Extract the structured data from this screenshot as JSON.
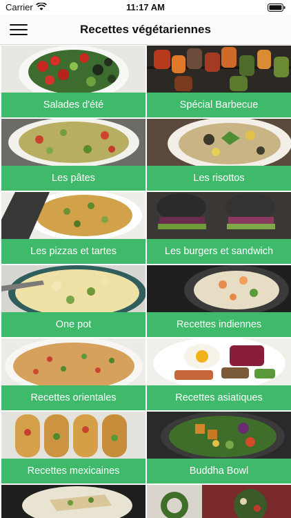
{
  "status_bar": {
    "carrier": "Carrier",
    "time": "11:17 AM"
  },
  "header": {
    "title": "Recettes végétariennes"
  },
  "categories": [
    {
      "label": "Salades d'été"
    },
    {
      "label": "Spécial Barbecue"
    },
    {
      "label": "Les pâtes"
    },
    {
      "label": "Les risottos"
    },
    {
      "label": "Les pizzas et tartes"
    },
    {
      "label": "Les burgers et sandwich"
    },
    {
      "label": "One pot"
    },
    {
      "label": "Recettes indiennes"
    },
    {
      "label": "Recettes orientales"
    },
    {
      "label": "Recettes asiatiques"
    },
    {
      "label": "Recettes mexicaines"
    },
    {
      "label": "Buddha Bowl"
    }
  ],
  "colors": {
    "label_background": "#3fb96a",
    "label_text": "#ffffff"
  }
}
